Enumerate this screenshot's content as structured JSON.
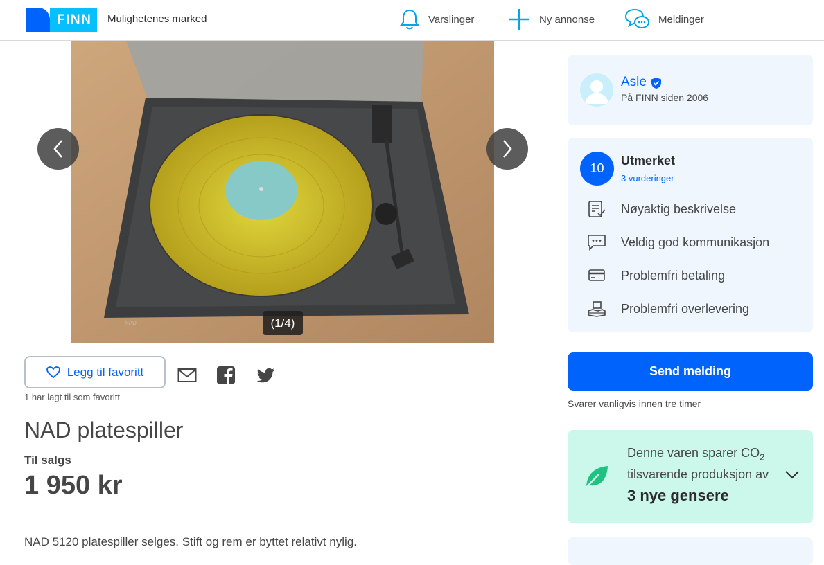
{
  "header": {
    "logo_text": "FINN",
    "tagline": "Mulighetenes marked",
    "nav": {
      "alerts": "Varslinger",
      "new_ad": "Ny annonse",
      "messages": "Meldinger"
    }
  },
  "gallery": {
    "counter": "(1/4)",
    "prev_icon": "chevron-left-icon",
    "next_icon": "chevron-right-icon"
  },
  "actions": {
    "favorite_label": "Legg til favoritt",
    "favorite_count": "1 har lagt til som favoritt",
    "share_icons": [
      "mail-icon",
      "facebook-icon",
      "twitter-icon"
    ]
  },
  "listing": {
    "title": "NAD platespiller",
    "status": "Til salgs",
    "price": "1 950 kr",
    "description": "NAD 5120 platespiller selges. Stift og rem er byttet relativt nylig."
  },
  "seller": {
    "name": "Asle",
    "since": "På FINN siden 2006"
  },
  "rating": {
    "score": "10",
    "label": "Utmerket",
    "count": "3 vurderinger",
    "items": [
      {
        "label": "Nøyaktig beskrivelse",
        "icon": "document-check-icon"
      },
      {
        "label": "Veldig god kommunikasjon",
        "icon": "chat-bubble-icon"
      },
      {
        "label": "Problemfri betaling",
        "icon": "credit-card-icon"
      },
      {
        "label": "Problemfri overlevering",
        "icon": "handover-icon"
      }
    ]
  },
  "contact": {
    "send_label": "Send melding",
    "reply_note": "Svarer vanligvis innen tre timer"
  },
  "eco": {
    "line1": "Denne varen sparer CO",
    "subscript": "2",
    "line2": "tilsvarende produksjon av",
    "highlight": "3 nye gensere"
  },
  "colors": {
    "brand_blue": "#0063fb",
    "brand_light_blue": "#06bffc",
    "card_bg": "#f0f6fe",
    "eco_bg": "#ccf8ec",
    "eco_leaf": "#20c281"
  }
}
